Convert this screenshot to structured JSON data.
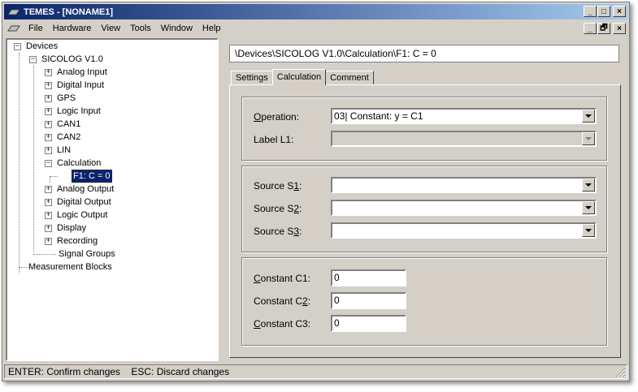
{
  "window": {
    "title": "TEMES - [NONAME1]",
    "minimize": "_",
    "maximize": "□",
    "close": "×",
    "restore": "🗗"
  },
  "menu": [
    "File",
    "Hardware",
    "View",
    "Tools",
    "Window",
    "Help"
  ],
  "tree": {
    "root": "Devices",
    "device": "SICOLOG V1.0",
    "items": [
      "Analog Input",
      "Digital Input",
      "GPS",
      "Logic Input",
      "CAN1",
      "CAN2",
      "LIN",
      "Calculation"
    ],
    "selected": "F1: C = 0",
    "items_after": [
      "Analog Output",
      "Digital Output",
      "Logic Output",
      "Display",
      "Recording",
      "Signal Groups"
    ],
    "measurement_blocks": "Measurement Blocks",
    "expand_symbol": "+",
    "collapse_symbol": "−"
  },
  "path": "\\Devices\\SICOLOG V1.0\\Calculation\\F1: C = 0",
  "tabs": [
    "Settings",
    "Calculation",
    "Comment"
  ],
  "active_tab": "Calculation",
  "operation": {
    "label_pre": "",
    "label_u": "O",
    "label_post": "peration:",
    "value": "03| Constant: y = C1"
  },
  "label_l1": {
    "label": "Label L1:",
    "value": ""
  },
  "sources": [
    {
      "label_pre": "Source S",
      "label_u": "1",
      "label_post": ":",
      "value": ""
    },
    {
      "label_pre": "Source S",
      "label_u": "2",
      "label_post": ":",
      "value": ""
    },
    {
      "label_pre": "Source S",
      "label_u": "3",
      "label_post": ":",
      "value": ""
    }
  ],
  "constants": [
    {
      "label_pre": "",
      "label_u": "C",
      "label_post": "onstant C1:",
      "value": "0"
    },
    {
      "label_pre": "Constant C",
      "label_u": "2",
      "label_post": ":",
      "value": "0"
    },
    {
      "label_pre": "",
      "label_u": "C",
      "label_post": "onstant C3:",
      "value": "0"
    }
  ],
  "status": "ENTER: Confirm changes    ESC: Discard changes",
  "colors": {
    "titlebar_start": "#0a246a",
    "titlebar_end": "#a6caf0",
    "face": "#d4d0c8",
    "selection": "#0a246a"
  }
}
